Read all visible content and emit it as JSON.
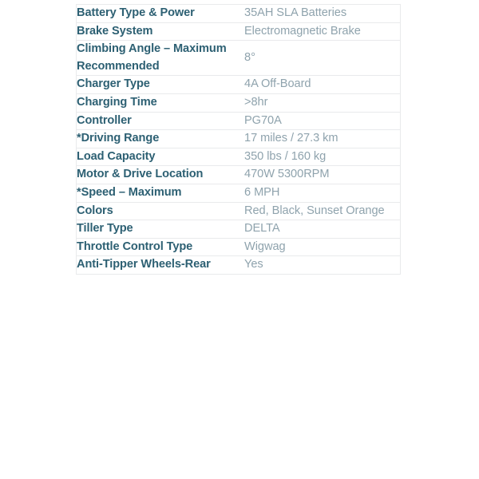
{
  "theme": {
    "page_background": "#ffffff",
    "table_background": "#ffffff",
    "border_color": "#e9eaec",
    "label_color": "#2d6073",
    "value_color": "#8fa3ad"
  },
  "spec_table": {
    "rows": [
      {
        "label": "Battery Type & Power",
        "value": "35AH SLA Batteries"
      },
      {
        "label": "Brake System",
        "value": "Electromagnetic Brake"
      },
      {
        "label": "Climbing Angle – Maximum Recommended",
        "value": "8°"
      },
      {
        "label": "Charger Type",
        "value": "4A Off-Board"
      },
      {
        "label": "Charging Time",
        "value": ">8hr"
      },
      {
        "label": "Controller",
        "value": "PG70A"
      },
      {
        "label": "*Driving Range",
        "value": "17 miles / 27.3 km"
      },
      {
        "label": "Load Capacity",
        "value": "350 lbs / 160 kg"
      },
      {
        "label": "Motor & Drive Location",
        "value": "470W 5300RPM"
      },
      {
        "label": "*Speed – Maximum",
        "value": "6 MPH"
      },
      {
        "label": "Colors",
        "value": "Red, Black, Sunset Orange"
      },
      {
        "label": "Tiller Type",
        "value": "DELTA"
      },
      {
        "label": "Throttle Control Type",
        "value": "Wigwag"
      },
      {
        "label": "Anti-Tipper Wheels-Rear",
        "value": "Yes"
      }
    ]
  }
}
